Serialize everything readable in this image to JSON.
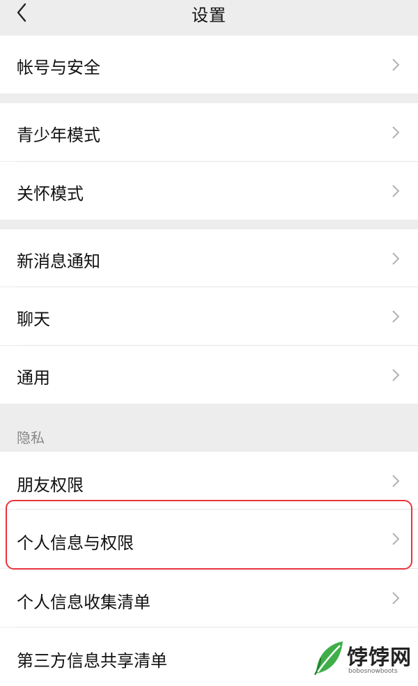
{
  "header": {
    "title": "设置"
  },
  "groups": [
    {
      "items": [
        {
          "label": "帐号与安全"
        }
      ]
    },
    {
      "items": [
        {
          "label": "青少年模式"
        },
        {
          "label": "关怀模式"
        }
      ]
    },
    {
      "items": [
        {
          "label": "新消息通知"
        },
        {
          "label": "聊天"
        },
        {
          "label": "通用"
        }
      ]
    }
  ],
  "privacy": {
    "section_label": "隐私",
    "items": [
      {
        "label": "朋友权限"
      },
      {
        "label": "个人信息与权限"
      },
      {
        "label": "个人信息收集清单"
      },
      {
        "label": "第三方信息共享清单"
      }
    ]
  },
  "watermark": {
    "text": "饽饽网",
    "url": "bobosnowboots"
  },
  "colors": {
    "highlight": "#e8323c",
    "background": "#ededed",
    "row": "#ffffff"
  }
}
